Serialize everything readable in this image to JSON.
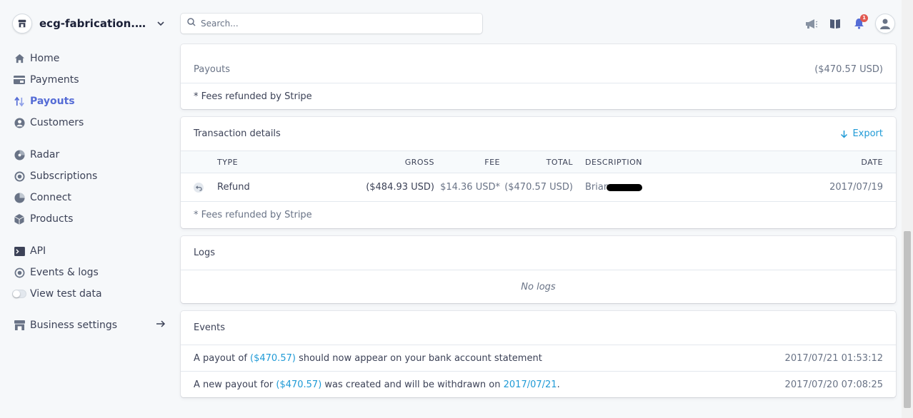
{
  "account": {
    "name": "ecg-fabrication.mybi..."
  },
  "sidebar": {
    "items": [
      {
        "label": "Home",
        "icon": "home-icon"
      },
      {
        "label": "Payments",
        "icon": "payments-icon"
      },
      {
        "label": "Payouts",
        "icon": "payouts-icon",
        "active": true
      },
      {
        "label": "Customers",
        "icon": "customers-icon"
      },
      {
        "label": "Radar",
        "icon": "radar-icon"
      },
      {
        "label": "Subscriptions",
        "icon": "subscriptions-icon"
      },
      {
        "label": "Connect",
        "icon": "connect-icon"
      },
      {
        "label": "Products",
        "icon": "products-icon"
      },
      {
        "label": "API",
        "icon": "api-icon"
      },
      {
        "label": "Events & logs",
        "icon": "events-icon"
      },
      {
        "label": "View test data",
        "icon": "toggle"
      },
      {
        "label": "Business settings",
        "icon": "store-icon"
      }
    ]
  },
  "search": {
    "placeholder": "Search..."
  },
  "notifications": {
    "count": "1"
  },
  "summary": {
    "payouts_label": "Payouts",
    "payouts_value": "($470.57 USD)",
    "footnote": "* Fees refunded by Stripe"
  },
  "transactions": {
    "title": "Transaction details",
    "export_label": "Export",
    "columns": {
      "type": "TYPE",
      "gross": "GROSS",
      "fee": "FEE",
      "total": "TOTAL",
      "description": "DESCRIPTION",
      "date": "DATE"
    },
    "rows": [
      {
        "type": "Refund",
        "gross": "($484.93 USD)",
        "fee": "$14.36 USD*",
        "total": "($470.57 USD)",
        "description": "Brian",
        "date": "2017/07/19"
      }
    ],
    "footnote": "* Fees refunded by Stripe"
  },
  "logs": {
    "title": "Logs",
    "empty": "No logs"
  },
  "events": {
    "title": "Events",
    "items": [
      {
        "pre": "A payout of ",
        "amount": "($470.57)",
        "post": " should now appear on your bank account statement",
        "timestamp": "2017/07/21 01:53:12"
      },
      {
        "pre": "A new payout for ",
        "amount": "($470.57)",
        "mid": " was created and will be withdrawn on ",
        "date": "2017/07/21",
        "post": ".",
        "timestamp": "2017/07/20 07:08:25"
      }
    ]
  },
  "colors": {
    "accent": "#556cd6",
    "link": "#1f9ad6",
    "background": "#f6f8fa",
    "badge": "#e25950"
  }
}
